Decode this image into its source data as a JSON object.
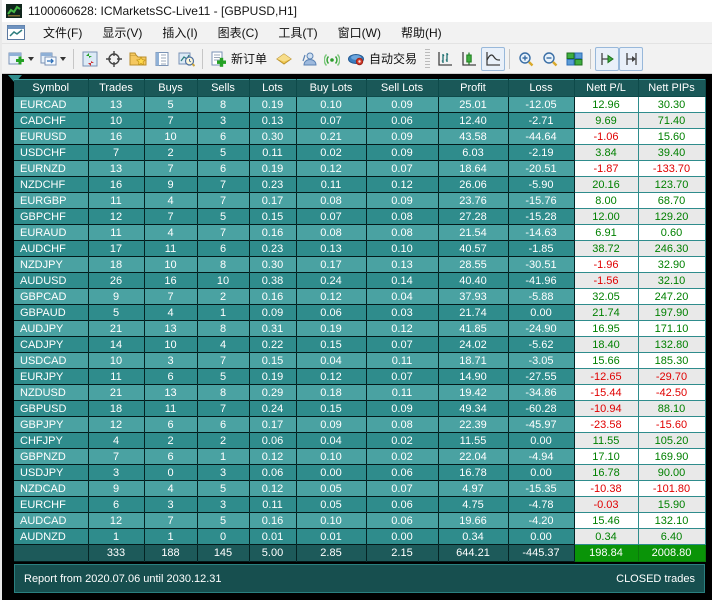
{
  "window": {
    "title": "1100060628: ICMarketsSC-Live11 - [GBPUSD,H1]"
  },
  "menu": {
    "items": [
      "文件(F)",
      "显示(V)",
      "插入(I)",
      "图表(C)",
      "工具(T)",
      "窗口(W)",
      "帮助(H)"
    ]
  },
  "toolbar": {
    "new_order_label": "新订单",
    "autotrade_label": "自动交易",
    "icons": [
      "new-chart-icon",
      "profiles-icon",
      "market-watch-icon",
      "crosshair-icon",
      "navigator-icon",
      "terminal-icon",
      "tester-icon",
      "new-order-icon",
      "metaeditor-icon",
      "community-icon",
      "signals-icon",
      "autotrade-icon",
      "bar-chart-icon",
      "candle-chart-icon",
      "line-chart-icon",
      "zoom-in-icon",
      "zoom-out-icon",
      "tile-windows-icon",
      "autoscroll-icon",
      "chart-shift-icon"
    ]
  },
  "colors": {
    "header_bg": "#1a5858",
    "row_light": "#4aa2a2",
    "row_dark": "#2f8c8c",
    "totals_bg": "#1d5a5a",
    "totals_green": "#0a9408",
    "profit_green": "#008000",
    "loss_red": "#e00000",
    "footer_bg": "#174f4f"
  },
  "table": {
    "columns": [
      "Symbol",
      "Trades",
      "Buys",
      "Sells",
      "Lots",
      "Buy Lots",
      "Sell Lots",
      "Profit",
      "Loss",
      "Nett P/L",
      "Nett PIPs"
    ],
    "rows": [
      [
        "EURCAD",
        "13",
        "5",
        "8",
        "0.19",
        "0.10",
        "0.09",
        "25.01",
        "-12.05",
        "12.96",
        "30.30"
      ],
      [
        "CADCHF",
        "10",
        "7",
        "3",
        "0.13",
        "0.07",
        "0.06",
        "12.40",
        "-2.71",
        "9.69",
        "71.40"
      ],
      [
        "EURUSD",
        "16",
        "10",
        "6",
        "0.30",
        "0.21",
        "0.09",
        "43.58",
        "-44.64",
        "-1.06",
        "15.60"
      ],
      [
        "USDCHF",
        "7",
        "2",
        "5",
        "0.11",
        "0.02",
        "0.09",
        "6.03",
        "-2.19",
        "3.84",
        "39.40"
      ],
      [
        "EURNZD",
        "13",
        "7",
        "6",
        "0.19",
        "0.12",
        "0.07",
        "18.64",
        "-20.51",
        "-1.87",
        "-133.70"
      ],
      [
        "NZDCHF",
        "16",
        "9",
        "7",
        "0.23",
        "0.11",
        "0.12",
        "26.06",
        "-5.90",
        "20.16",
        "123.70"
      ],
      [
        "EURGBP",
        "11",
        "4",
        "7",
        "0.17",
        "0.08",
        "0.09",
        "23.76",
        "-15.76",
        "8.00",
        "68.70"
      ],
      [
        "GBPCHF",
        "12",
        "7",
        "5",
        "0.15",
        "0.07",
        "0.08",
        "27.28",
        "-15.28",
        "12.00",
        "129.20"
      ],
      [
        "EURAUD",
        "11",
        "4",
        "7",
        "0.16",
        "0.08",
        "0.08",
        "21.54",
        "-14.63",
        "6.91",
        "0.60"
      ],
      [
        "AUDCHF",
        "17",
        "11",
        "6",
        "0.23",
        "0.13",
        "0.10",
        "40.57",
        "-1.85",
        "38.72",
        "246.30"
      ],
      [
        "NZDJPY",
        "18",
        "10",
        "8",
        "0.30",
        "0.17",
        "0.13",
        "28.55",
        "-30.51",
        "-1.96",
        "32.90"
      ],
      [
        "AUDUSD",
        "26",
        "16",
        "10",
        "0.38",
        "0.24",
        "0.14",
        "40.40",
        "-41.96",
        "-1.56",
        "32.10"
      ],
      [
        "GBPCAD",
        "9",
        "7",
        "2",
        "0.16",
        "0.12",
        "0.04",
        "37.93",
        "-5.88",
        "32.05",
        "247.20"
      ],
      [
        "GBPAUD",
        "5",
        "4",
        "1",
        "0.09",
        "0.06",
        "0.03",
        "21.74",
        "0.00",
        "21.74",
        "197.90"
      ],
      [
        "AUDJPY",
        "21",
        "13",
        "8",
        "0.31",
        "0.19",
        "0.12",
        "41.85",
        "-24.90",
        "16.95",
        "171.10"
      ],
      [
        "CADJPY",
        "14",
        "10",
        "4",
        "0.22",
        "0.15",
        "0.07",
        "24.02",
        "-5.62",
        "18.40",
        "132.80"
      ],
      [
        "USDCAD",
        "10",
        "3",
        "7",
        "0.15",
        "0.04",
        "0.11",
        "18.71",
        "-3.05",
        "15.66",
        "185.30"
      ],
      [
        "EURJPY",
        "11",
        "6",
        "5",
        "0.19",
        "0.12",
        "0.07",
        "14.90",
        "-27.55",
        "-12.65",
        "-29.70"
      ],
      [
        "NZDUSD",
        "21",
        "13",
        "8",
        "0.29",
        "0.18",
        "0.11",
        "19.42",
        "-34.86",
        "-15.44",
        "-42.50"
      ],
      [
        "GBPUSD",
        "18",
        "11",
        "7",
        "0.24",
        "0.15",
        "0.09",
        "49.34",
        "-60.28",
        "-10.94",
        "88.10"
      ],
      [
        "GBPJPY",
        "12",
        "6",
        "6",
        "0.17",
        "0.09",
        "0.08",
        "22.39",
        "-45.97",
        "-23.58",
        "-15.60"
      ],
      [
        "CHFJPY",
        "4",
        "2",
        "2",
        "0.06",
        "0.04",
        "0.02",
        "11.55",
        "0.00",
        "11.55",
        "105.20"
      ],
      [
        "GBPNZD",
        "7",
        "6",
        "1",
        "0.12",
        "0.10",
        "0.02",
        "22.04",
        "-4.94",
        "17.10",
        "169.90"
      ],
      [
        "USDJPY",
        "3",
        "0",
        "3",
        "0.06",
        "0.00",
        "0.06",
        "16.78",
        "0.00",
        "16.78",
        "90.00"
      ],
      [
        "NZDCAD",
        "9",
        "4",
        "5",
        "0.12",
        "0.05",
        "0.07",
        "4.97",
        "-15.35",
        "-10.38",
        "-101.80"
      ],
      [
        "EURCHF",
        "6",
        "3",
        "3",
        "0.11",
        "0.05",
        "0.06",
        "4.75",
        "-4.78",
        "-0.03",
        "15.90"
      ],
      [
        "AUDCAD",
        "12",
        "7",
        "5",
        "0.16",
        "0.10",
        "0.06",
        "19.66",
        "-4.20",
        "15.46",
        "132.10"
      ],
      [
        "AUDNZD",
        "1",
        "1",
        "0",
        "0.01",
        "0.01",
        "0.00",
        "0.34",
        "0.00",
        "0.34",
        "6.40"
      ]
    ],
    "totals": [
      "",
      "333",
      "188",
      "145",
      "5.00",
      "2.85",
      "2.15",
      "644.21",
      "-445.37",
      "198.84",
      "2008.80"
    ]
  },
  "footer": {
    "left": "Report from 2020.07.06 until 2030.12.31",
    "right": "CLOSED trades"
  }
}
